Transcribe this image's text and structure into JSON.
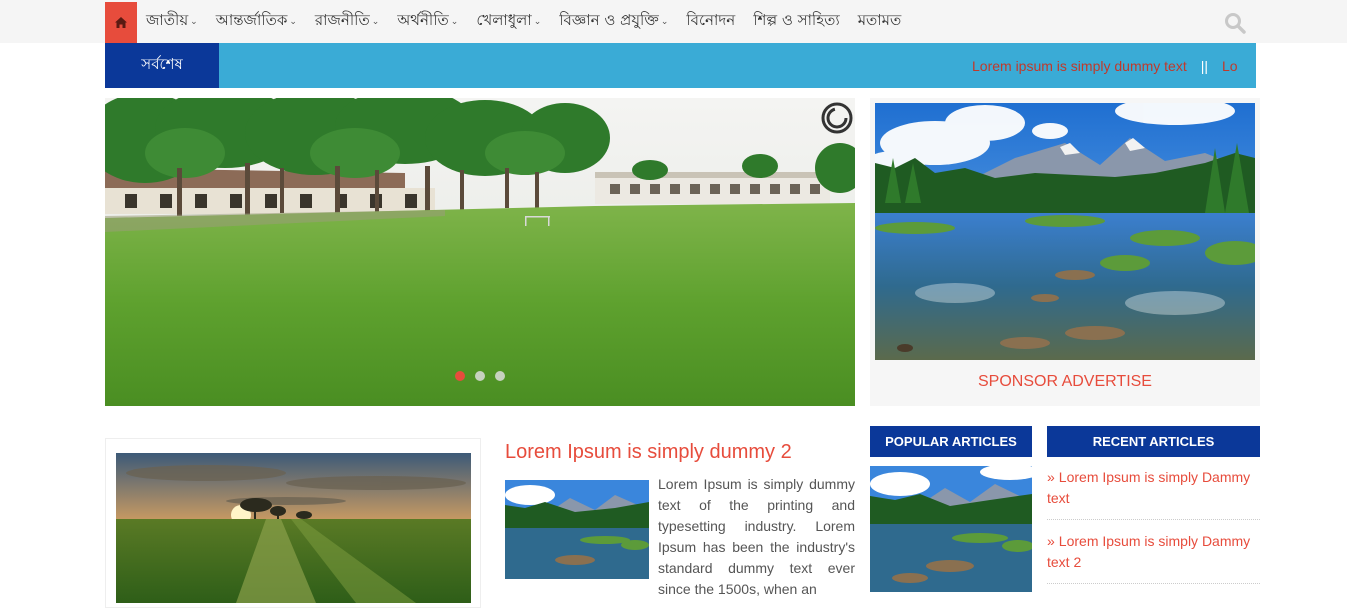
{
  "nav": {
    "home_icon": "home-icon",
    "items": [
      {
        "label": "জাতীয়",
        "dropdown": true
      },
      {
        "label": "আন্তর্জাতিক",
        "dropdown": true
      },
      {
        "label": "রাজনীতি",
        "dropdown": true
      },
      {
        "label": "অর্থনীতি",
        "dropdown": true
      },
      {
        "label": "খেলাধুলা",
        "dropdown": true
      },
      {
        "label": "বিজ্ঞান ও প্রযুক্তি",
        "dropdown": true
      },
      {
        "label": "বিনোদন",
        "dropdown": false
      },
      {
        "label": "শিল্প ও সাহিত্য",
        "dropdown": false
      },
      {
        "label": "মতামত",
        "dropdown": false
      }
    ],
    "search_icon": "search-icon"
  },
  "ticker": {
    "label": "সর্বশেষ",
    "items": [
      "Lorem ipsum is simply dummy text",
      "Lo"
    ],
    "separator": "||"
  },
  "slider": {
    "dot_count": 3,
    "active_dot": 0
  },
  "sponsor": {
    "label": "SPONSOR ADVERTISE"
  },
  "feature": {
    "title": "Lorem Ipsum is simply dummy 2",
    "text": "Lorem Ipsum is simply dummy text of the printing and typesetting industry. Lorem Ipsum has been the industry's standard dummy text ever since the 1500s, when an"
  },
  "popular": {
    "heading": "POPULAR ARTICLES"
  },
  "recent": {
    "heading": "RECENT ARTICLES",
    "items": [
      {
        "label": "Lorem Ipsum is simply Dammy text"
      },
      {
        "label": "Lorem Ipsum is simply Dammy text 2"
      }
    ]
  },
  "colors": {
    "accent_red": "#e74c3c",
    "navy": "#0b3899",
    "ticker_blue": "#3aabd6"
  }
}
